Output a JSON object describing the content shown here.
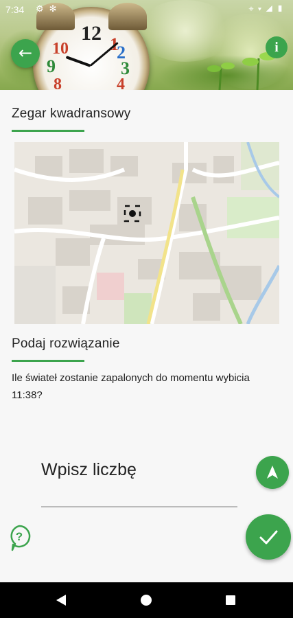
{
  "status_bar": {
    "time": "7:34",
    "left_icons": [
      "gear-icon",
      "notification-icon"
    ],
    "right_icons": [
      "location-icon",
      "wifi-icon",
      "signal-icon",
      "battery-icon"
    ]
  },
  "header": {
    "clock_numbers": [
      "12",
      "1",
      "2",
      "3",
      "4",
      "8",
      "9",
      "10"
    ]
  },
  "puzzle": {
    "title": "Zegar kwadransowy"
  },
  "solution": {
    "title": "Podaj rozwiązanie",
    "question": "Ile świateł zostanie zapalonych do momentu wybicia 11:38?"
  },
  "answer": {
    "placeholder": "Wpisz liczbę"
  },
  "colors": {
    "accent": "#3ca44d",
    "background": "#f7f7f7",
    "text": "#222222",
    "nav_bar": "#000000"
  }
}
